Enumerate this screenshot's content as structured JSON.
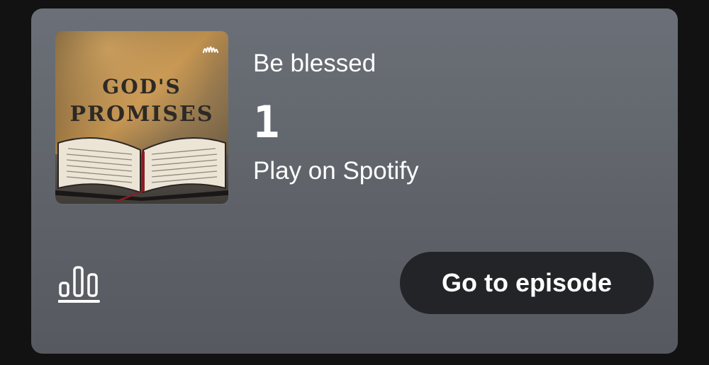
{
  "card": {
    "cover": {
      "title_line1": "GOD'S",
      "title_line2": "PROMISES",
      "icon": "anchor-icon"
    },
    "show_name": "Be blessed",
    "episode_title": "1",
    "play_on_label": "Play on Spotify",
    "go_button_label": "Go to episode",
    "bars_icon": "audio-bars-icon"
  },
  "colors": {
    "background": "#121212",
    "card_top": "#6b7078",
    "card_bottom": "#565a60",
    "button_bg": "#232428",
    "text": "#ffffff"
  }
}
